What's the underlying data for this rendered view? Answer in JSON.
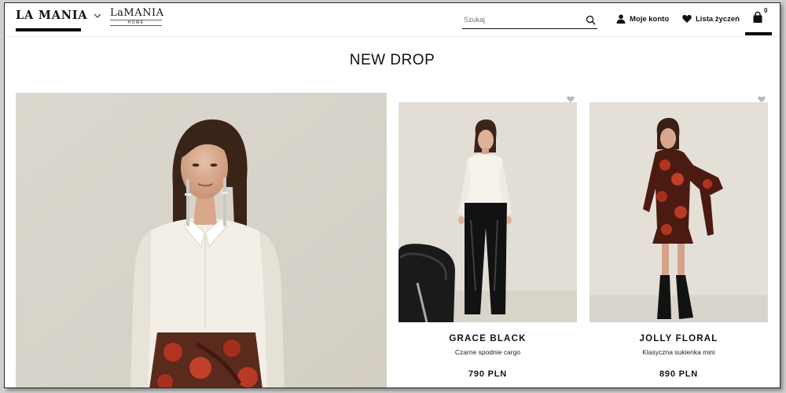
{
  "header": {
    "logo_main": "LA MANIA",
    "logo_home_big": "LaMANIA",
    "logo_home_small": "HOME",
    "search_placeholder": "Szukaj",
    "account_label": "Moje konto",
    "wishlist_label": "Lista życzeń",
    "cart_count": "0"
  },
  "main": {
    "section_title": "NEW DROP",
    "products": [
      {
        "name": "GRACE BLACK",
        "description": "Czarne spodnie cargo",
        "price": "790 PLN"
      },
      {
        "name": "JOLLY FLORAL",
        "description": "Klasyczna sukienka mini",
        "price": "890 PLN"
      }
    ]
  },
  "icons": {
    "search": "search-icon",
    "account": "user-icon",
    "wishlist": "heart-icon",
    "cart": "shopping-bag-icon",
    "logo_dropdown": "chevron-down-icon"
  },
  "colors": {
    "accent": "#000000",
    "background": "#ffffff",
    "photo_backdrop": "#d9d5cc"
  }
}
